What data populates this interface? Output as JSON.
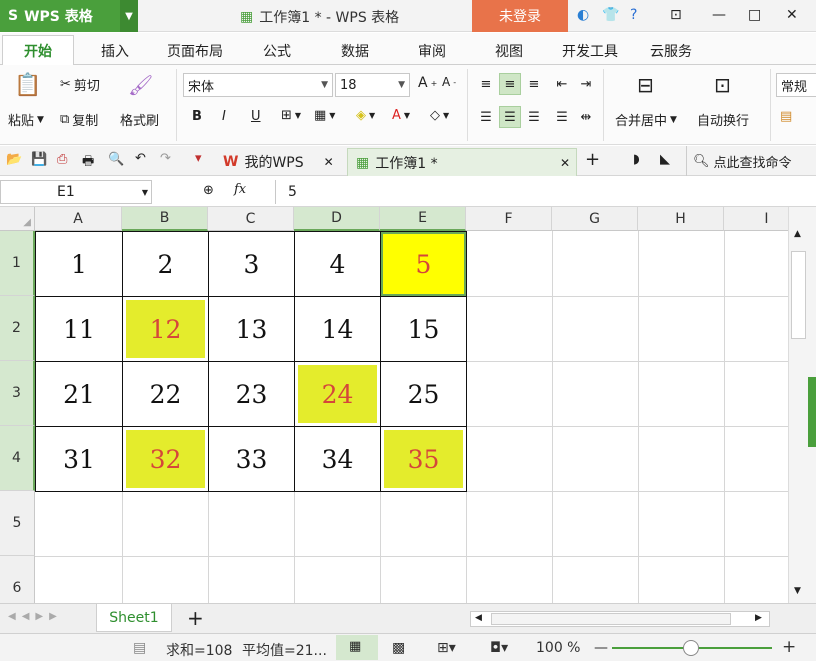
{
  "app": {
    "name": "WPS 表格",
    "window_title": "工作簿1 * - WPS 表格",
    "login_label": "未登录"
  },
  "menu": [
    "开始",
    "插入",
    "页面布局",
    "公式",
    "数据",
    "审阅",
    "视图",
    "开发工具",
    "云服务"
  ],
  "ribbon": {
    "paste": "粘贴",
    "cut": "剪切",
    "copy": "复制",
    "format_painter": "格式刷",
    "font_name": "宋体",
    "font_size": "18",
    "bold": "B",
    "italic": "I",
    "underline": "U",
    "merge_center": "合并居中",
    "wrap_text": "自动换行",
    "number_format": "常规"
  },
  "tabs": {
    "my_wps": "我的WPS",
    "workbook": "工作簿1 *",
    "search": "点此查找命令"
  },
  "formula_bar": {
    "cell_ref": "E1",
    "fx": "fx",
    "value": "5"
  },
  "columns": [
    "A",
    "B",
    "C",
    "D",
    "E",
    "F",
    "G",
    "H",
    "I"
  ],
  "rows": [
    "1",
    "2",
    "3",
    "4",
    "5",
    "6"
  ],
  "cells": [
    [
      "1",
      "2",
      "3",
      "4",
      "5"
    ],
    [
      "11",
      "12",
      "13",
      "14",
      "15"
    ],
    [
      "21",
      "22",
      "23",
      "24",
      "25"
    ],
    [
      "31",
      "32",
      "33",
      "34",
      "35"
    ]
  ],
  "highlight_color": "#e4ec2c",
  "highlight_text_color": "#d5463a",
  "sheet_tab": "Sheet1",
  "status": {
    "sum": "求和=108",
    "average": "平均值=21...",
    "zoom": "100 %"
  },
  "colors": {
    "accent": "#4a9f3c",
    "login": "#e8734a"
  }
}
